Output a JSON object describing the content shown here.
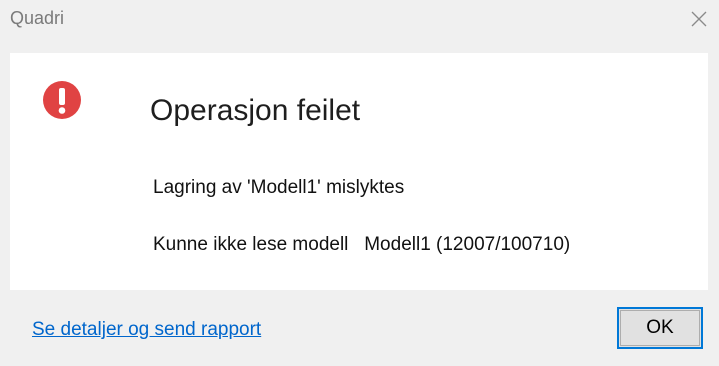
{
  "window": {
    "title": "Quadri",
    "close_icon": "close-icon"
  },
  "message": {
    "icon": "error-icon",
    "icon_color": "#e04343",
    "heading": "Operasjon feilet",
    "line1": "Lagring av 'Modell1' mislyktes",
    "line2": "Kunne ikke lese modell   Modell1 (12007/100710)"
  },
  "footer": {
    "details_link": "Se detaljer og send rapport",
    "ok_label": "OK",
    "link_color": "#0066cc",
    "focus_color": "#0078d7"
  }
}
